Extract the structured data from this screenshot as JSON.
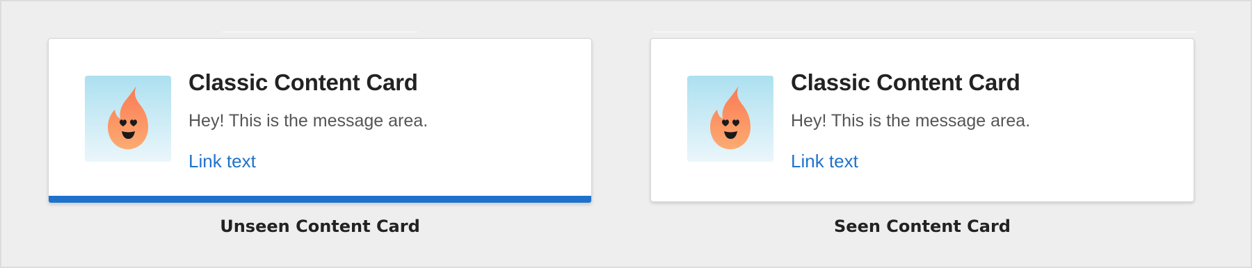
{
  "colors": {
    "background": "#eeeeee",
    "card_background": "#ffffff",
    "unseen_indicator": "#1f72cc",
    "link": "#1f72cc",
    "title": "#222222",
    "message": "#555555",
    "image_gradient_top": "#ace0f0",
    "image_gradient_bottom": "#ebf6fb",
    "flame_top": "#fb7a54",
    "flame_bottom": "#fcab72"
  },
  "cards": [
    {
      "state": "unseen",
      "image_icon": "flame-face-icon",
      "title": "Classic Content Card",
      "message": "Hey! This is the message area.",
      "link_text": "Link text",
      "caption": "Unseen Content Card"
    },
    {
      "state": "seen",
      "image_icon": "flame-face-icon",
      "title": "Classic Content Card",
      "message": "Hey! This is the message area.",
      "link_text": "Link text",
      "caption": "Seen Content Card"
    }
  ]
}
